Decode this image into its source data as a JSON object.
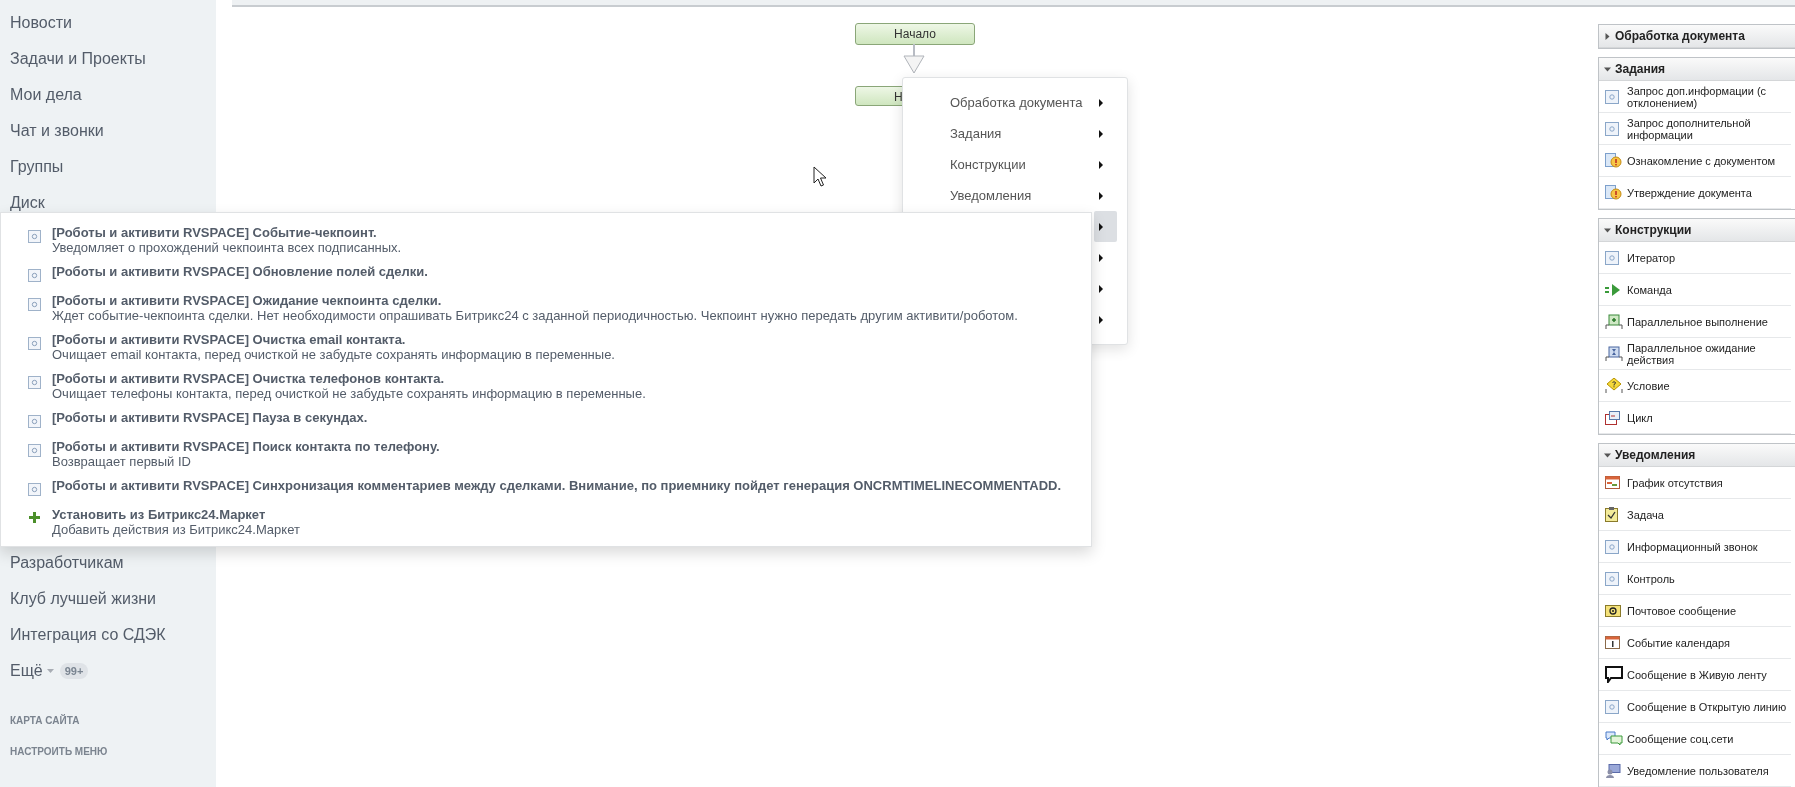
{
  "sidebar": {
    "items": [
      {
        "label": "Новости"
      },
      {
        "label": "Задачи и Проекты"
      },
      {
        "label": "Мои дела"
      },
      {
        "label": "Чат и звонки"
      },
      {
        "label": "Группы"
      },
      {
        "label": "Диск"
      }
    ],
    "lower_items": [
      {
        "label": "Разработчикам"
      },
      {
        "label": "Клуб лучшей жизни"
      },
      {
        "label": "Интеграция со СДЭК"
      }
    ],
    "more": {
      "label": "Ещё",
      "badge": "99+"
    },
    "links": [
      "КАРТА САЙТА",
      "НАСТРОИТЬ МЕНЮ"
    ]
  },
  "diagram": {
    "nodes": [
      "Начало",
      "Н"
    ]
  },
  "context_menu": {
    "items": [
      {
        "label": "Обработка документа",
        "selected": false
      },
      {
        "label": "Задания",
        "selected": false
      },
      {
        "label": "Конструкции",
        "selected": false
      },
      {
        "label": "Уведомления",
        "selected": false
      },
      {
        "selected": true
      },
      {
        "selected": false
      },
      {
        "selected": false
      },
      {
        "selected": false
      }
    ]
  },
  "submenu": {
    "items": [
      {
        "kind": "activity",
        "title": "[Роботы и активити RVSPACE] Событие-чекпоинт.",
        "description": "Уведомляет о прохождений чекпоинта всех подписанных."
      },
      {
        "kind": "activity",
        "title": "[Роботы и активити RVSPACE] Обновление полей сделки."
      },
      {
        "kind": "activity",
        "title": "[Роботы и активити RVSPACE] Ожидание чекпоинта сделки.",
        "description": "Ждет событие-чекпоинта сделки. Нет необходимости опрашивать Битрикс24 с заданной периодичностью. Чекпоинт нужно передать другим активити/роботом."
      },
      {
        "kind": "activity",
        "title": "[Роботы и активити RVSPACE] Очистка email контакта.",
        "description": "Очищает email контакта, перед очисткой не забудьте сохранять информацию в переменные."
      },
      {
        "kind": "activity",
        "title": "[Роботы и активити RVSPACE] Очистка телефонов контакта.",
        "description": "Очищает телефоны контакта, перед очисткой не забудьте сохранять информацию в переменные."
      },
      {
        "kind": "activity",
        "title": "[Роботы и активити RVSPACE] Пауза в секундах."
      },
      {
        "kind": "activity",
        "title": "[Роботы и активити RVSPACE] Поиск контакта по телефону.",
        "description": "Возвращает первый ID"
      },
      {
        "kind": "activity",
        "title": "[Роботы и активити RVSPACE] Синхронизация комментариев между сделками. Внимание, по приемнику пойдет генерация ONCRMTIMELINECOMMENTADD."
      },
      {
        "kind": "market",
        "title": "Установить из Битрикс24.Маркет",
        "description": "Добавить действия из Битрикс24.Маркет"
      }
    ]
  },
  "palette": {
    "groups": [
      {
        "title": "Обработка документа",
        "expanded": false
      },
      {
        "title": "Задания",
        "expanded": true,
        "items": [
          {
            "kind": "generic",
            "label": "Запрос доп.информации (с отклонением)"
          },
          {
            "kind": "generic",
            "label": "Запрос дополнительной информации"
          },
          {
            "kind": "warning-doc",
            "label": "Ознакомление с документом"
          },
          {
            "kind": "warning-doc",
            "label": "Утверждение документа"
          }
        ]
      },
      {
        "title": "Конструкции",
        "expanded": true,
        "items": [
          {
            "kind": "generic",
            "label": "Итератор"
          },
          {
            "kind": "command",
            "label": "Команда"
          },
          {
            "kind": "parallel",
            "label": "Параллельное выполнение"
          },
          {
            "kind": "parallel-wait",
            "label": "Параллельное ожидание действия"
          },
          {
            "kind": "condition",
            "label": "Условие"
          },
          {
            "kind": "loop",
            "label": "Цикл"
          }
        ]
      },
      {
        "title": "Уведомления",
        "expanded": true,
        "items": [
          {
            "kind": "absence",
            "label": "График отсутствия"
          },
          {
            "kind": "task",
            "label": "Задача"
          },
          {
            "kind": "generic",
            "label": "Информационный звонок"
          },
          {
            "kind": "generic",
            "label": "Контроль"
          },
          {
            "kind": "mail",
            "label": "Почтовое сообщение"
          },
          {
            "kind": "calendar",
            "label": "Событие календаря"
          },
          {
            "kind": "speech",
            "label": "Сообщение в Живую ленту"
          },
          {
            "kind": "generic",
            "label": "Сообщение в Открытую линию"
          },
          {
            "kind": "chat",
            "label": "Сообщение соц.сети"
          },
          {
            "kind": "user",
            "label": "Уведомление пользователя"
          }
        ]
      }
    ]
  }
}
